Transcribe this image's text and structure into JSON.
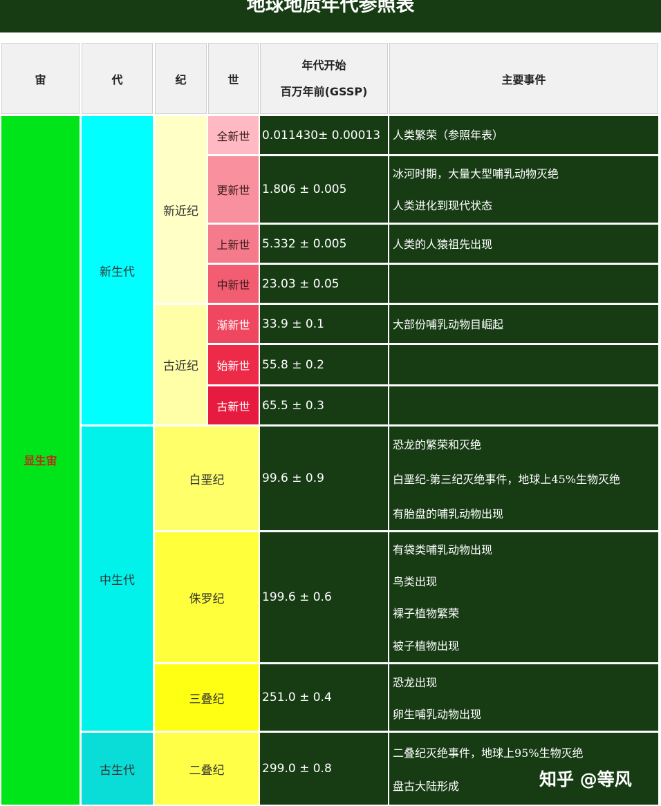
{
  "title": "地球地质年代参照表",
  "headers": {
    "eon": "宙",
    "era": "代",
    "period": "纪",
    "epoch": "世",
    "start_line1": "年代开始",
    "start_line2": "百万年前(GSSP)",
    "events": "主要事件"
  },
  "eon": "显生宙",
  "eras": {
    "cenozoic": "新生代",
    "mesozoic": "中生代",
    "paleozoic": "古生代"
  },
  "periods": {
    "neogene": "新近纪",
    "paleogene": "古近纪",
    "cretaceous": "白垩纪",
    "jurassic": "侏罗纪",
    "triassic": "三叠纪",
    "permian": "二叠纪"
  },
  "epochs": [
    "全新世",
    "更新世",
    "上新世",
    "中新世",
    "渐新世",
    "始新世",
    "古新世"
  ],
  "values": {
    "holocene": "0.011430± 0.00013",
    "pleistocene": "1.806 ± 0.005",
    "pliocene": "5.332 ± 0.005",
    "miocene": "23.03 ± 0.05",
    "oligocene": "33.9 ± 0.1",
    "eocene": "55.8 ± 0.2",
    "paleocene": "65.5 ± 0.3",
    "cretaceous": "99.6 ± 0.9",
    "jurassic": "199.6 ± 0.6",
    "triassic": "251.0 ± 0.4",
    "permian": "299.0 ± 0.8"
  },
  "events": {
    "holocene": [
      "人类繁荣（参照年表）"
    ],
    "pleistocene": [
      "冰河时期，大量大型哺乳动物灭绝",
      "人类进化到现代状态"
    ],
    "pliocene": [
      "人类的人猿祖先出现"
    ],
    "oligocene": [
      "大部份哺乳动物目崛起"
    ],
    "cretaceous": [
      "恐龙的繁荣和灭绝",
      "白垩纪-第三纪灭绝事件，地球上45%生物灭绝",
      "有胎盘的哺乳动物出现"
    ],
    "jurassic": [
      "有袋类哺乳动物出现",
      "鸟类出现",
      "裸子植物繁荣",
      "被子植物出现"
    ],
    "triassic": [
      "恐龙出现",
      "卵生哺乳动物出现"
    ],
    "permian": [
      "二叠纪灭绝事件，地球上95%生物灭绝",
      "盘古大陆形成"
    ]
  },
  "colors": {
    "eon": "#00e51a",
    "cenozoic": "#00ffff",
    "mesozoic": "#00f2ea",
    "paleozoic": "#0adcd8",
    "neogene": "#ffffc6",
    "paleogene": "#ffffa8",
    "cretaceous": "#ffff6a",
    "jurassic": "#ffff3c",
    "triassic": "#ffff14",
    "permian": "#ffff48",
    "event_bg": "#173c14"
  },
  "watermark": "知乎 @等风"
}
